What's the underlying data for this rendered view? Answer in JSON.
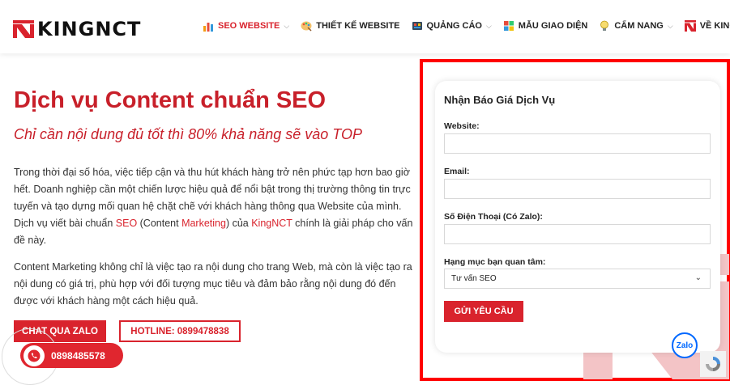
{
  "header": {
    "logo_text": "KINGNCT",
    "nav": [
      {
        "label": "SEO WEBSITE",
        "icon": "bar-chart-icon",
        "has_dropdown": true,
        "active": true
      },
      {
        "label": "THIẾT KẾ WEBSITE",
        "icon": "palette-icon",
        "has_dropdown": false
      },
      {
        "label": "QUẢNG CÁO",
        "icon": "megaphone-icon",
        "has_dropdown": true
      },
      {
        "label": "MẪU GIAO DIỆN",
        "icon": "windows-grid-icon",
        "has_dropdown": false
      },
      {
        "label": "CẨM NANG",
        "icon": "lightbulb-icon",
        "has_dropdown": true
      },
      {
        "label": "VỀ KINGNCT",
        "icon": "kingnct-logo-icon",
        "has_dropdown": true
      }
    ],
    "chevron": "⌵"
  },
  "hero": {
    "title": "Dịch vụ Content chuẩn SEO",
    "subtitle": "Chỉ cần nội dung đủ tốt thì 80% khả năng sẽ vào TOP",
    "para1_a": "Trong thời đại số hóa, việc tiếp cận và thu hút khách hàng trở nên phức tạp hơn bao giờ hết. Doanh nghiệp cần một chiến lược hiệu quả để nổi bật trong thị trường thông tin trực tuyến và tạo dựng mối quan hệ chặt chẽ với khách hàng thông qua Website của mình. Dịch vụ viết bài chuẩn ",
    "para1_link1": "SEO",
    "para1_b": " (Content ",
    "para1_link2": "Marketing",
    "para1_c": ") của ",
    "para1_link3": "KingNCT",
    "para1_d": " chính là giải pháp cho vấn đề này.",
    "para2": "Content Marketing không chỉ là việc tạo ra nội dung cho trang Web, mà còn là việc tạo ra nội dung có giá trị, phù hợp với đối tượng mục tiêu và đảm bảo rằng nội dung đó đến được với khách hàng một cách hiệu quả.",
    "btn_zalo": "CHAT QUA ZALO",
    "btn_hotline": "HOTLINE: 0899478838",
    "phone": "0898485578"
  },
  "form": {
    "title": "Nhận Báo Giá Dịch Vụ",
    "website_label": "Website:",
    "email_label": "Email:",
    "phone_label": "Số Điện Thoại (Có Zalo):",
    "category_label": "Hạng mục bạn quan tâm:",
    "category_value": "Tư vấn SEO",
    "submit_label": "GỬI YÊU CẦU",
    "select_chevron": "⌄"
  },
  "floating": {
    "zalo_label": "Zalo"
  },
  "colors": {
    "brand_red": "#d9232d",
    "highlight_frame": "#ff0000",
    "zalo_blue": "#0068ff"
  }
}
